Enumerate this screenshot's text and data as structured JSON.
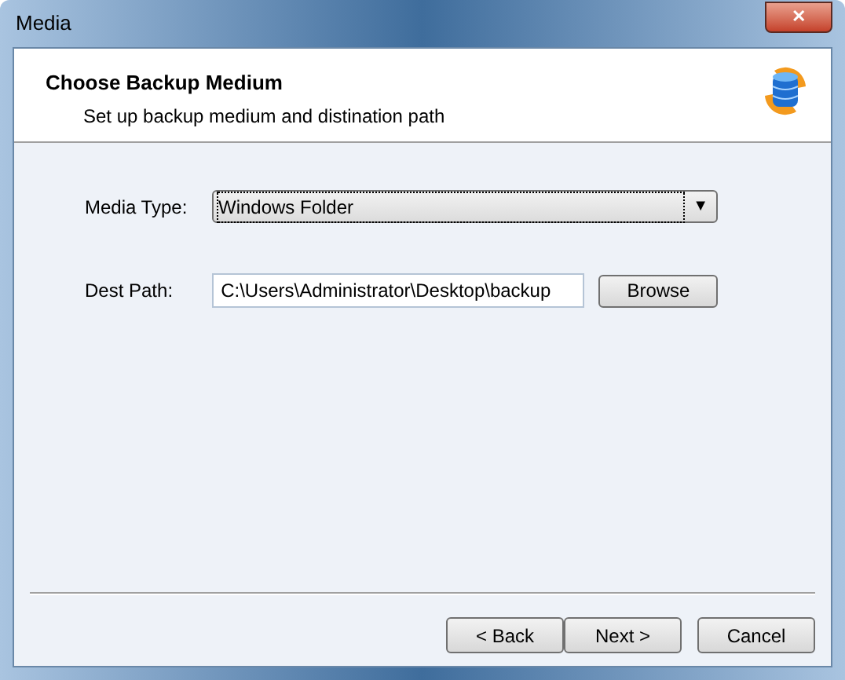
{
  "window": {
    "title": "Media",
    "close": "✕"
  },
  "header": {
    "title": "Choose Backup Medium",
    "subtitle": "Set up backup medium and distination path"
  },
  "media_type": {
    "label": "Media Type:",
    "value": "Windows Folder",
    "arrow": "▼"
  },
  "dest_path": {
    "label": "Dest Path:",
    "value": "C:\\Users\\Administrator\\Desktop\\backup",
    "button": "Browse"
  },
  "buttons": [
    "< Back",
    "Next >",
    "Cancel"
  ]
}
